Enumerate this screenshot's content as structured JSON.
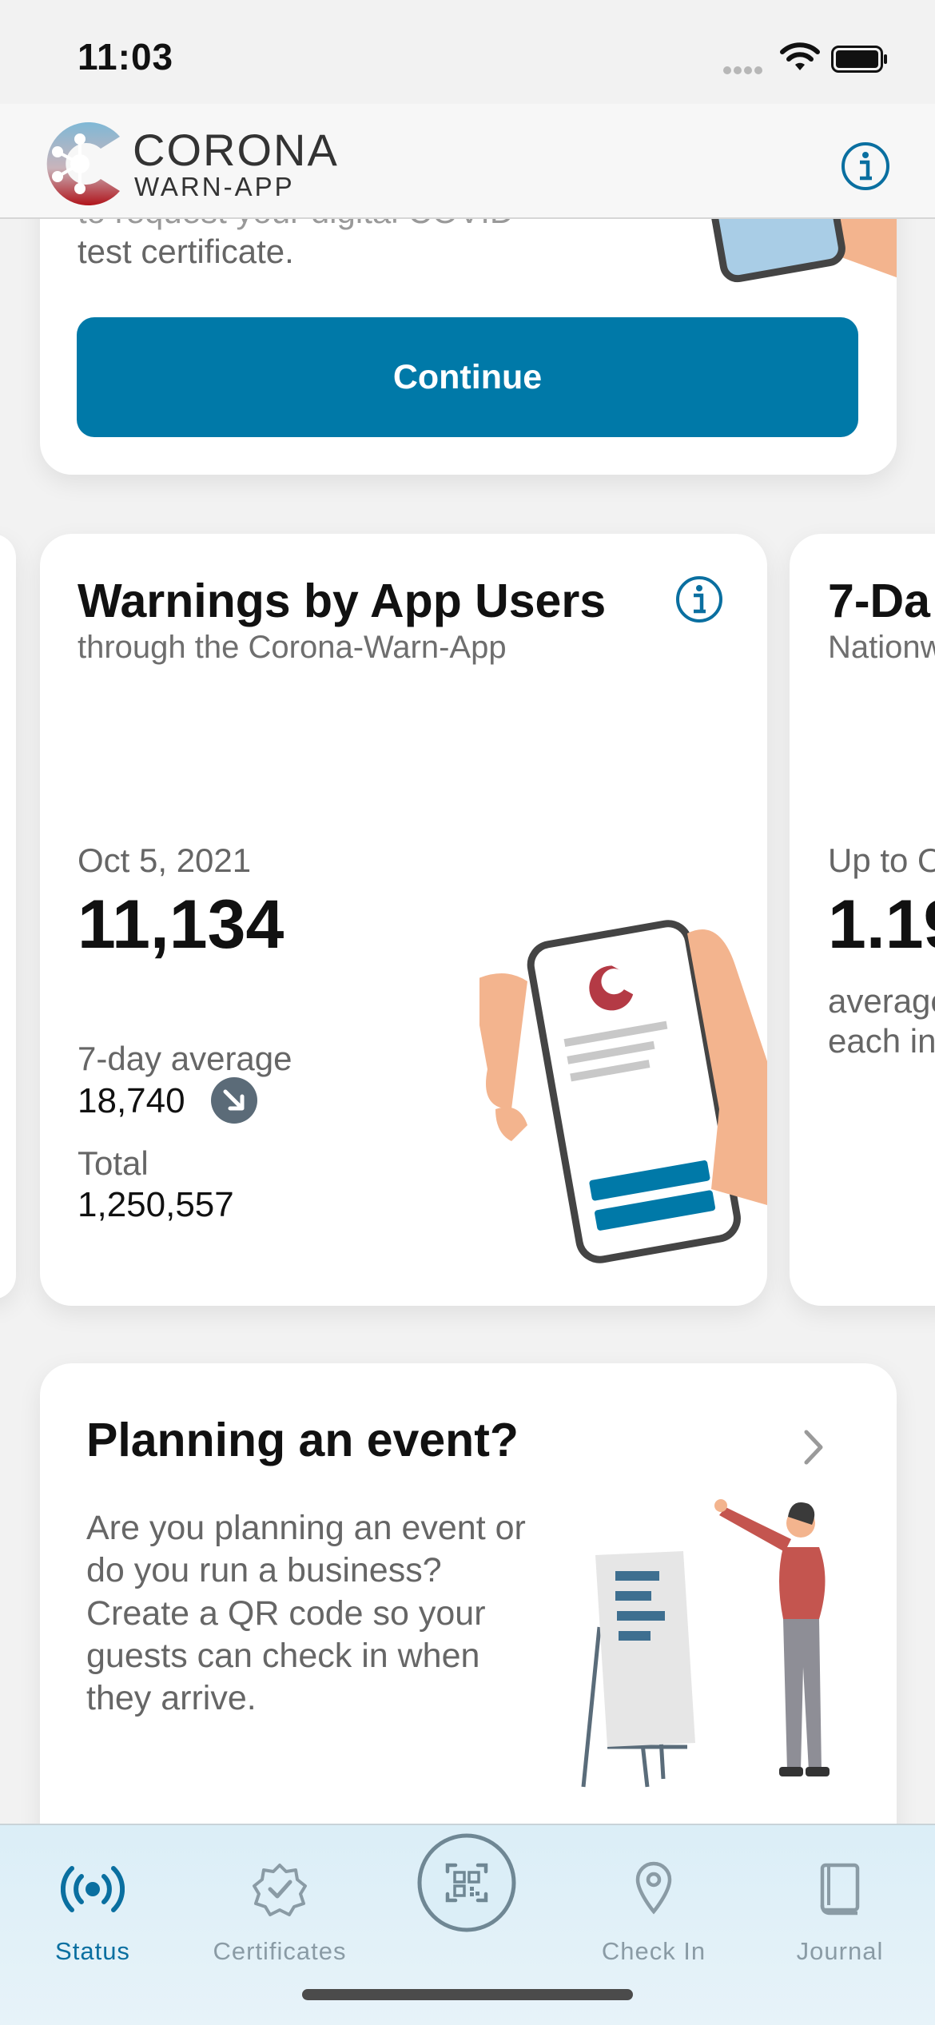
{
  "status_bar": {
    "time": "11:03"
  },
  "header": {
    "logo_line1": "CORONA",
    "logo_line2": "WARN-APP",
    "info_icon": "info-icon"
  },
  "test_card": {
    "text_cut": "to request your digital COVID",
    "text": "test certificate.",
    "button": "Continue"
  },
  "warnings_card": {
    "title": "Warnings by App Users",
    "subtitle": "through the Corona-Warn-App",
    "date": "Oct 5, 2021",
    "value": "11,134",
    "avg_label": "7-day average",
    "avg_value": "18,740",
    "trend": "down",
    "total_label": "Total",
    "total_value": "1,250,557"
  },
  "incidence_card_partial": {
    "title": "7-Da",
    "subtitle": "Nationw",
    "upto": "Up to O",
    "value": "1.19",
    "note_line1": "average",
    "note_line2": "each in"
  },
  "event_card": {
    "title": "Planning an event?",
    "text": "Are you planning an event or do you run a business? Create a QR code so your guests can check in when they arrive."
  },
  "tabbar": {
    "tabs": [
      {
        "label": "Status",
        "icon": "broadcast-icon",
        "active": true
      },
      {
        "label": "Certificates",
        "icon": "certificate-badge-icon",
        "active": false
      },
      {
        "label": "",
        "icon": "qr-scan-icon",
        "active": false
      },
      {
        "label": "Check In",
        "icon": "location-pin-icon",
        "active": false
      },
      {
        "label": "Journal",
        "icon": "book-icon",
        "active": false
      }
    ]
  },
  "colors": {
    "accent": "#0079a8",
    "tab_active": "#0a6fa0",
    "tab_inactive": "#8a9ba5"
  }
}
